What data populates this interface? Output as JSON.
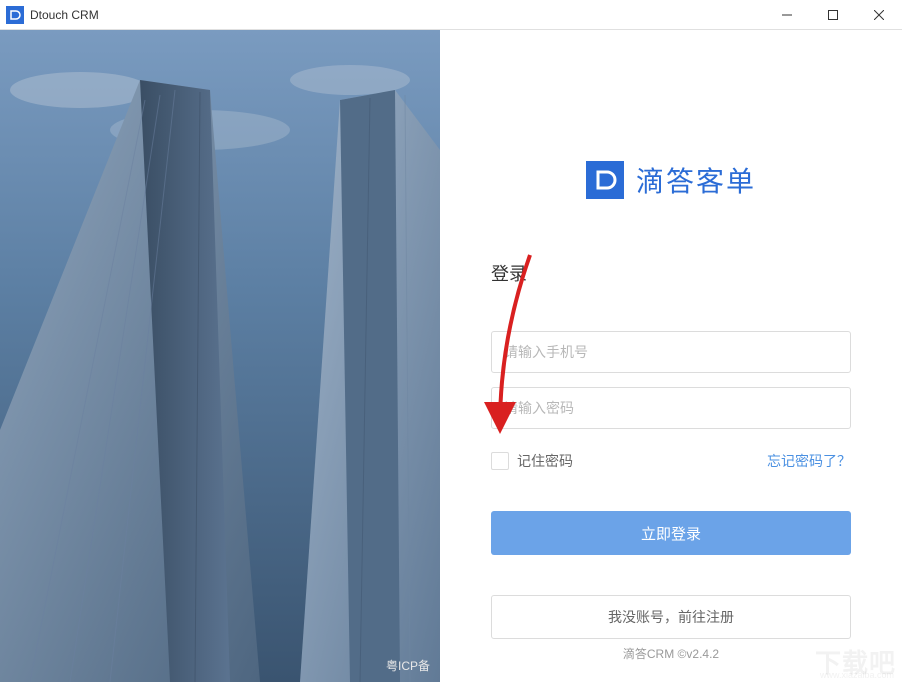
{
  "window": {
    "title": "Dtouch CRM"
  },
  "brand": {
    "name": "滴答客单"
  },
  "login": {
    "heading": "登录",
    "phone_placeholder": "请输入手机号",
    "password_placeholder": "请输入密码",
    "remember_label": "记住密码",
    "forgot_link": "忘记密码了？",
    "login_button": "立即登录",
    "register_button": "我没账号，前往注册"
  },
  "footer": {
    "icp": "粤ICP备",
    "version": "滴答CRM ©v2.4.2"
  },
  "watermark": {
    "main": "下载吧",
    "sub": "www.xiazaiba.com"
  }
}
